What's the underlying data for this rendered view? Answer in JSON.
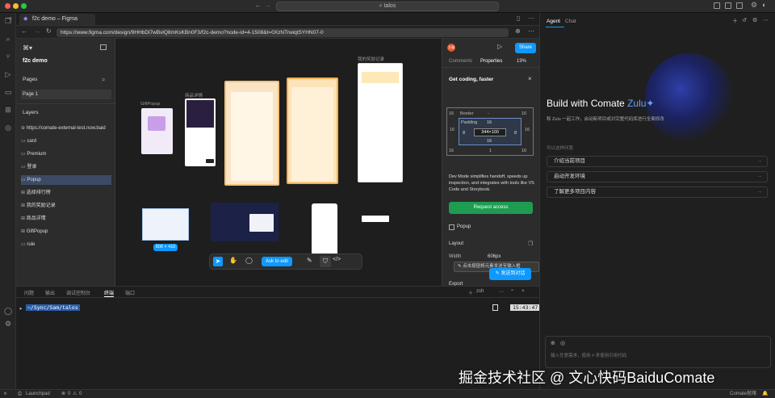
{
  "window": {
    "search": "talos"
  },
  "browser": {
    "tab_title": "f2c demo – Figma",
    "url": "https://www.figma.com/design/9HHbDl7wBvlQ8mKsKBn0F3/f2c-demo?node-id=4-1508&t=0XzNTrwiqtSYHN07-0"
  },
  "figma_left": {
    "file_name": "f2c demo",
    "pages_label": "Pages",
    "page_item": "Page 1",
    "layers_label": "Layers",
    "layers": [
      "https://comate-external-test.now.baid",
      "card",
      "Premium",
      "登录",
      "Popup",
      "选择排行榜",
      "我的奖励记录",
      "商品详情",
      "GiftPopup",
      "rule"
    ]
  },
  "canvas": {
    "label_gift": "GiftPopup",
    "label_detail": "商品详情",
    "label_reward": "我的奖励记录",
    "size_badge": "808 × 410",
    "ask_to_edit": "Ask to edit"
  },
  "figma_right": {
    "share": "Share",
    "tab_comments": "Comments",
    "tab_properties": "Properties",
    "zoom": "19%",
    "banner_title": "Get coding, faster",
    "border_label": "Border",
    "padding_label": "Padding",
    "dim": "344×100",
    "pad_top": "16",
    "pad_bottom": "16",
    "pad_left": "8",
    "pad_right": "8",
    "outer_left": "16",
    "outer_right": "16",
    "outer_bottom": "1",
    "corner": "16",
    "dash": "-",
    "devmode_text": "Dev Mode simplifies handoff, speeds up inspection, and integrates with tools like VS Code and Storybook.",
    "request_access": "Request access",
    "popup_layer": "Popup",
    "layout_label": "Layout",
    "width_label": "Width",
    "width_value": "606px",
    "tooltip": "点击按钮将元素发送至输入框",
    "export_label": "Export",
    "send_button": "发送到对话"
  },
  "terminal": {
    "tabs": [
      "问题",
      "输出",
      "调试控制台",
      "终端",
      "端口"
    ],
    "shell": "zsh",
    "path": "~/Sync/Sam/talos",
    "time": "15:43:47"
  },
  "right_panel": {
    "tab_agent": "Agent",
    "tab_chat": "Chat",
    "heading": "Build with Comate",
    "heading_accent": "Zulu",
    "subtitle": "和 Zulu 一起工作，启动新项目或对完整代码库进行全面修改",
    "prompt_label": "可以这样问我",
    "suggestions": [
      "介绍当前项目",
      "启动开发环境",
      "了解更多项目内容"
    ],
    "input_placeholder": "输入任意需求，使用 # 来使用引用代码"
  },
  "status": {
    "launchpad": "Launchpad",
    "problems": "0",
    "warnings": "0",
    "right": "Comate就绪"
  },
  "watermark": "掘金技术社区 @ 文心快码BaiduComate",
  "colors": {
    "accent": "#0d99ff",
    "green": "#1e9c52",
    "selection": "#3d4a66"
  }
}
